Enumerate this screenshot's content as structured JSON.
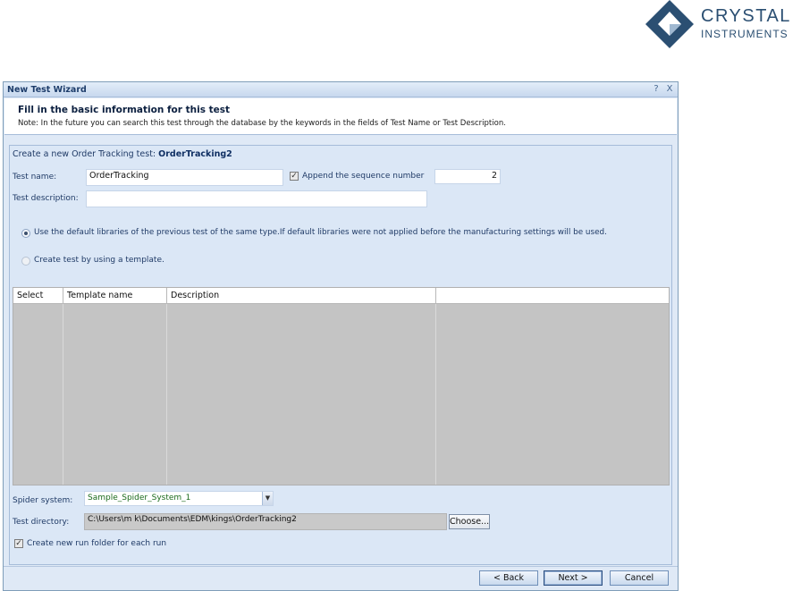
{
  "logo": {
    "line1": "CRYSTAL",
    "line2": "INSTRUMENTS",
    "colors": {
      "dark": "#2b4f72",
      "light": "#9fb8d1"
    }
  },
  "window": {
    "title": "New Test Wizard",
    "help_glyph": "?",
    "close_glyph": "X"
  },
  "header": {
    "title": "Fill in the basic information for this test",
    "note": "Note: In the future you can search this test through the database by the keywords in the fields of Test Name or Test Description."
  },
  "form": {
    "create_prefix": "Create a new Order Tracking test:",
    "create_name": "OrderTracking2",
    "test_name_label": "Test name:",
    "test_name_value": "OrderTracking",
    "append_seq_label": "Append the sequence number",
    "append_seq_checked": true,
    "sequence_value": "2",
    "test_desc_label": "Test description:",
    "test_desc_value": "",
    "radio_default_label": "Use the default libraries of the previous test of the same type.If default libraries were not applied before the manufacturing settings will be used.",
    "radio_template_label": "Create test by using a template.",
    "selected_radio": "default"
  },
  "template_table": {
    "columns": [
      "Select",
      "Template name",
      "Description",
      ""
    ],
    "rows": []
  },
  "bottom": {
    "spider_label": "Spider system:",
    "spider_value": "Sample_Spider_System_1",
    "dir_label": "Test directory:",
    "dir_value": "C:\\Users\\m k\\Documents\\EDM\\kings\\OrderTracking2",
    "choose_label": "Choose...",
    "run_folder_label": "Create new run folder for each run",
    "run_folder_checked": true
  },
  "buttons": {
    "back": "< Back",
    "next": "Next >",
    "cancel": "Cancel"
  },
  "checkmark": "✓"
}
